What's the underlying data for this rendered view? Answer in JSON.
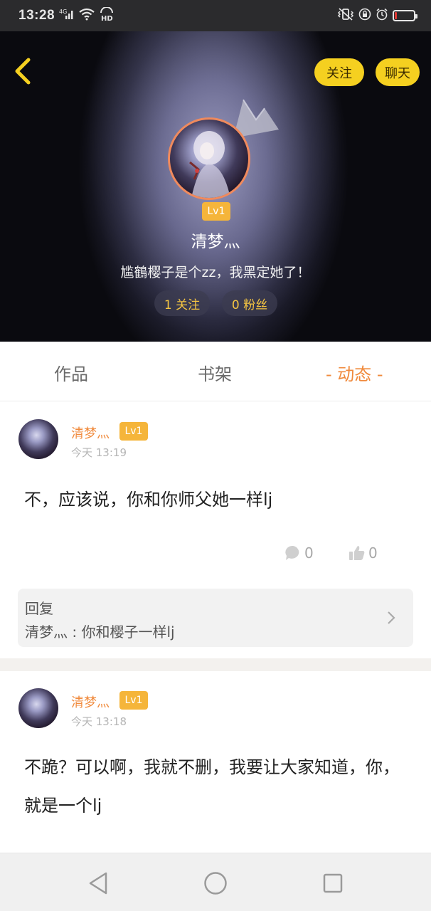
{
  "status_bar": {
    "time": "13:28",
    "network": "4G",
    "hd": "HD",
    "battery_level_percent": 12,
    "battery_color": "#e53935"
  },
  "header": {
    "back_icon": "chevron-left-icon",
    "follow_label": "关注",
    "chat_label": "聊天",
    "accent_color": "#f5d020"
  },
  "profile": {
    "level": "Lv1",
    "name": "清梦灬",
    "signature": "尴鶴樱子是个zz，我黑定她了！",
    "following": "1 关注",
    "fans": "0 粉丝"
  },
  "tabs": [
    {
      "label": "作品"
    },
    {
      "label": "书架"
    },
    {
      "label": "- 动态 -",
      "active": true
    }
  ],
  "posts": [
    {
      "author": "清梦灬",
      "level": "Lv1",
      "time": "今天 13:19",
      "text": "不，应该说，你和你师父她一样lj",
      "comments": "0",
      "likes": "0",
      "reply": {
        "title": "回复",
        "text": "清梦灬 : 你和樱子一样lj"
      }
    },
    {
      "author": "清梦灬",
      "level": "Lv1",
      "time": "今天 13:18",
      "text": "不跪？可以啊，我就不删，我要让大家知道，你，就是一个lj"
    }
  ],
  "nav": {
    "back_icon": "triangle-back-icon",
    "home_icon": "circle-home-icon",
    "recents_icon": "square-recents-icon"
  }
}
